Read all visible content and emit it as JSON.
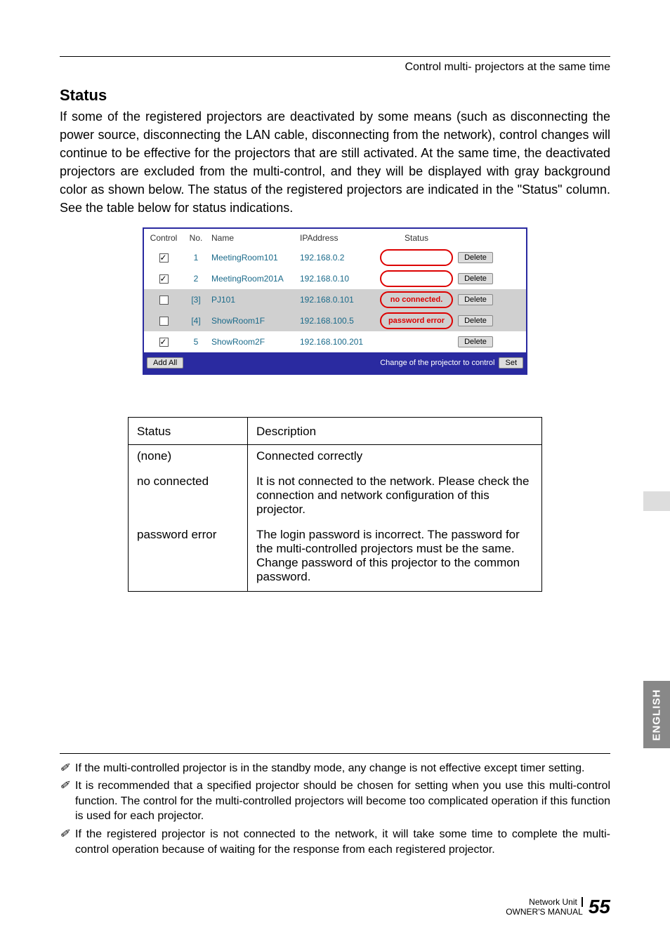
{
  "header": {
    "breadcrumb": "Control multi- projectors at the same time"
  },
  "section": {
    "title": "Status",
    "paragraph": "If some of the registered projectors are deactivated by some means (such as disconnecting the power source, disconnecting the LAN cable, disconnecting from the network), control changes will continue to be effective for the projectors that are still activated. At the same time, the deactivated projectors are excluded from the multi-control, and they will be displayed with gray background color as shown below. The status of the registered projectors are indicated in the \"Status\" column. See the table below for status indications."
  },
  "proj_table": {
    "headers": {
      "control": "Control",
      "no": "No.",
      "name": "Name",
      "ip": "IPAddress",
      "status": "Status"
    },
    "rows": [
      {
        "checked": true,
        "gray": false,
        "no": "1",
        "name": "MeetingRoom101",
        "ip": "192.168.0.2",
        "status": "",
        "oval": true,
        "delete": "Delete"
      },
      {
        "checked": true,
        "gray": false,
        "no": "2",
        "name": "MeetingRoom201A",
        "ip": "192.168.0.10",
        "status": "",
        "oval": true,
        "delete": "Delete"
      },
      {
        "checked": false,
        "gray": true,
        "no": "[3]",
        "name": "PJ101",
        "ip": "192.168.0.101",
        "status": "no connected.",
        "oval": true,
        "delete": "Delete"
      },
      {
        "checked": false,
        "gray": true,
        "no": "[4]",
        "name": "ShowRoom1F",
        "ip": "192.168.100.5",
        "status": "password error",
        "oval": true,
        "delete": "Delete"
      },
      {
        "checked": true,
        "gray": false,
        "no": "5",
        "name": "ShowRoom2F",
        "ip": "192.168.100.201",
        "status": "",
        "oval": false,
        "delete": "Delete"
      }
    ],
    "footer": {
      "add_all": "Add All",
      "change_label": "Change of the projector to control",
      "set": "Set"
    }
  },
  "desc_table": {
    "header": {
      "status": "Status",
      "description": "Description"
    },
    "rows": [
      {
        "status": "(none)",
        "description": "Connected correctly"
      },
      {
        "status": "no connected",
        "description": "It is not connected to the network. Please check the connection and network configuration of this projector."
      },
      {
        "status": "password error",
        "description": "The login password is incorrect. The password for the multi-controlled projectors must be the same. Change password of this projector to the common password."
      }
    ]
  },
  "notes": [
    "If the multi-controlled projector is in the standby mode, any change is not effective except timer setting.",
    "It is recommended that a specified projector should be chosen for setting when you use this multi-control function. The control for the multi-controlled projectors will become too complicated operation if this function is used for each projector.",
    "If the registered projector is not connected to the network, it will take some time to complete the multi-control operation because of waiting for the response from each registered projector."
  ],
  "footer": {
    "line1": "Network Unit",
    "line2": "OWNER'S MANUAL",
    "page": "55"
  },
  "side_tab": "ENGLISH",
  "note_glyph": "✐"
}
